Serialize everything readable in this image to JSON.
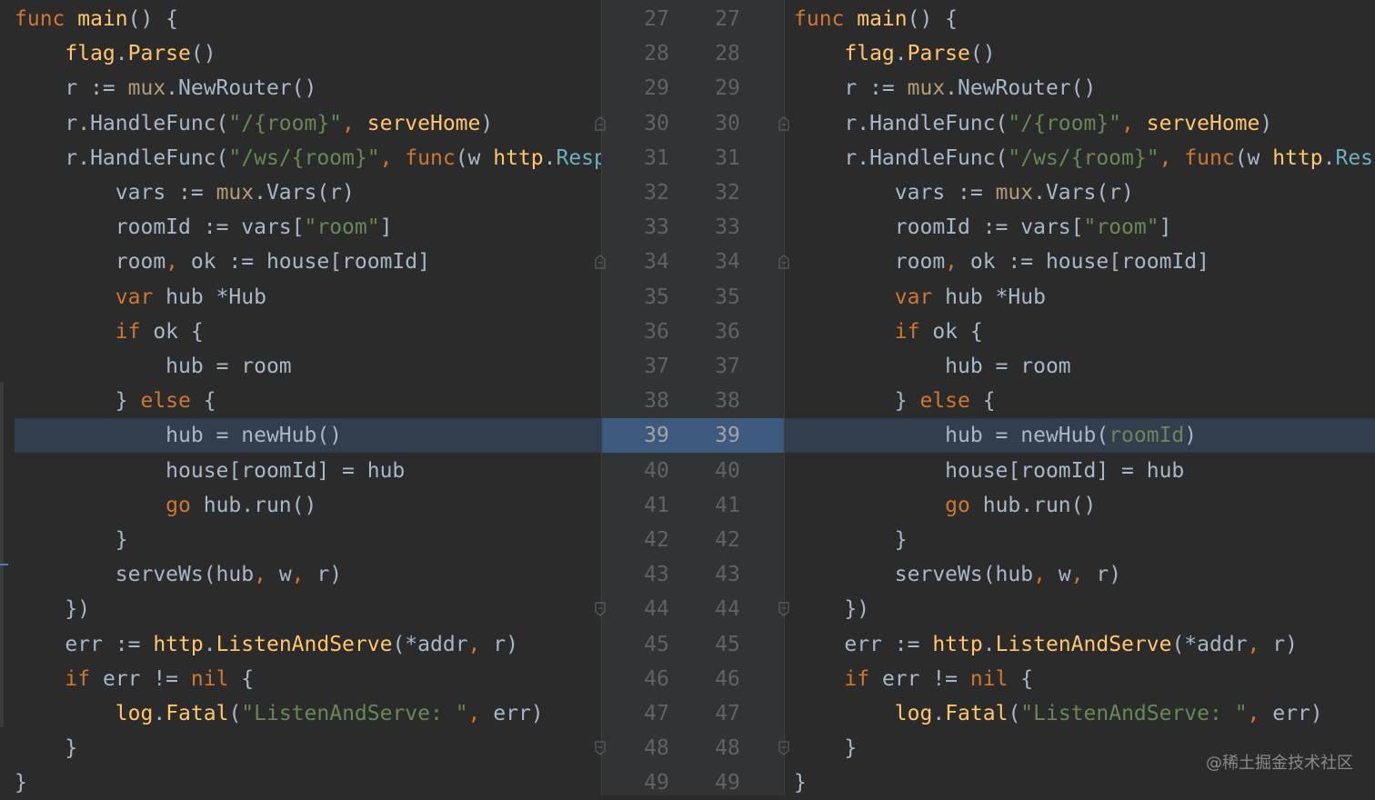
{
  "left_lines": [
    "<span class=\"kw\">func</span> <span class=\"fn\">main</span>() {",
    "    <span class=\"fn\">flag</span>.<span class=\"fn\">Parse</span>()",
    "    r := <span class=\"pkg\">mux</span>.NewRouter()",
    "    r.HandleFunc(<span class=\"str\">\"/{room}\"</span><span class=\"kw\">,</span> <span class=\"fn\">serveHome</span>)",
    "    r.HandleFunc(<span class=\"str\">\"/ws/{room}\"</span><span class=\"kw\">,</span> <span class=\"kw\">func</span>(w <span class=\"fn\">http</span>.<span class=\"typ\">Resp</span>",
    "        vars := <span class=\"pkg\">mux</span>.Vars(r)",
    "        roomId := vars[<span class=\"str\">\"room\"</span>]",
    "        room<span class=\"kw\">,</span> ok := house[roomId]",
    "        <span class=\"kw\">var</span> hub *Hub",
    "        <span class=\"kw\">if</span> ok {",
    "            hub = room",
    "        } <span class=\"kw\">else</span> {",
    "            hub = newHub()",
    "            house[roomId] = hub",
    "            <span class=\"kw\">go</span> hub.run()",
    "        }",
    "        serveWs(hub<span class=\"kw\">,</span> w<span class=\"kw\">,</span> r)",
    "    })",
    "    err := <span class=\"fn\">http</span>.<span class=\"fn\">ListenAndServe</span>(*addr<span class=\"kw\">,</span> r)",
    "    <span class=\"kw\">if</span> err != <span class=\"kw\">nil</span> {",
    "        <span class=\"fn\">log</span>.<span class=\"fn\">Fatal</span>(<span class=\"str\">\"ListenAndServe: \"</span><span class=\"kw\">,</span> err)",
    "    }",
    "}"
  ],
  "right_lines": [
    "<span class=\"kw\">func</span> <span class=\"fn\">main</span>() {",
    "    <span class=\"fn\">flag</span>.<span class=\"fn\">Parse</span>()",
    "    r := <span class=\"pkg\">mux</span>.NewRouter()",
    "    r.HandleFunc(<span class=\"str\">\"/{room}\"</span><span class=\"kw\">,</span> <span class=\"fn\">serveHome</span>)",
    "    r.HandleFunc(<span class=\"str\">\"/ws/{room}\"</span><span class=\"kw\">,</span> <span class=\"kw\">func</span>(w <span class=\"fn\">http</span>.<span class=\"typ\">Resp</span>",
    "        vars := <span class=\"pkg\">mux</span>.Vars(r)",
    "        roomId := vars[<span class=\"str\">\"room\"</span>]",
    "        room<span class=\"kw\">,</span> ok := house[roomId]",
    "        <span class=\"kw\">var</span> hub *Hub",
    "        <span class=\"kw\">if</span> ok {",
    "            hub = room",
    "        } <span class=\"kw\">else</span> {",
    "            hub = newHub(<span class=\"str\">roomId</span>)",
    "            house[roomId] = hub",
    "            <span class=\"kw\">go</span> hub.run()",
    "        }",
    "        serveWs(hub<span class=\"kw\">,</span> w<span class=\"kw\">,</span> r)",
    "    })",
    "    err := <span class=\"fn\">http</span>.<span class=\"fn\">ListenAndServe</span>(*addr<span class=\"kw\">,</span> r)",
    "    <span class=\"kw\">if</span> err != <span class=\"kw\">nil</span> {",
    "        <span class=\"fn\">log</span>.<span class=\"fn\">Fatal</span>(<span class=\"str\">\"ListenAndServe: \"</span><span class=\"kw\">,</span> err)",
    "    }",
    "}"
  ],
  "line_numbers": [
    "27",
    "28",
    "29",
    "30",
    "31",
    "32",
    "33",
    "34",
    "35",
    "36",
    "37",
    "38",
    "39",
    "40",
    "41",
    "42",
    "43",
    "44",
    "45",
    "46",
    "47",
    "48",
    "49"
  ],
  "highlighted_line": "39",
  "fold_markers": {
    "open_at": [
      "30",
      "34"
    ],
    "close_at": [
      "44",
      "48"
    ]
  },
  "fold_icon": "fold-marker-icon",
  "colors": {
    "background": "#2b2b2b",
    "gutter": "#313335",
    "highlight": "#323d4e",
    "highlight_gutter": "#3c5a7e",
    "keyword": "#cc7832",
    "function": "#ffc66d",
    "string": "#6a8759",
    "text": "#a9b7c6"
  },
  "watermark": "@稀土掘金技术社区"
}
